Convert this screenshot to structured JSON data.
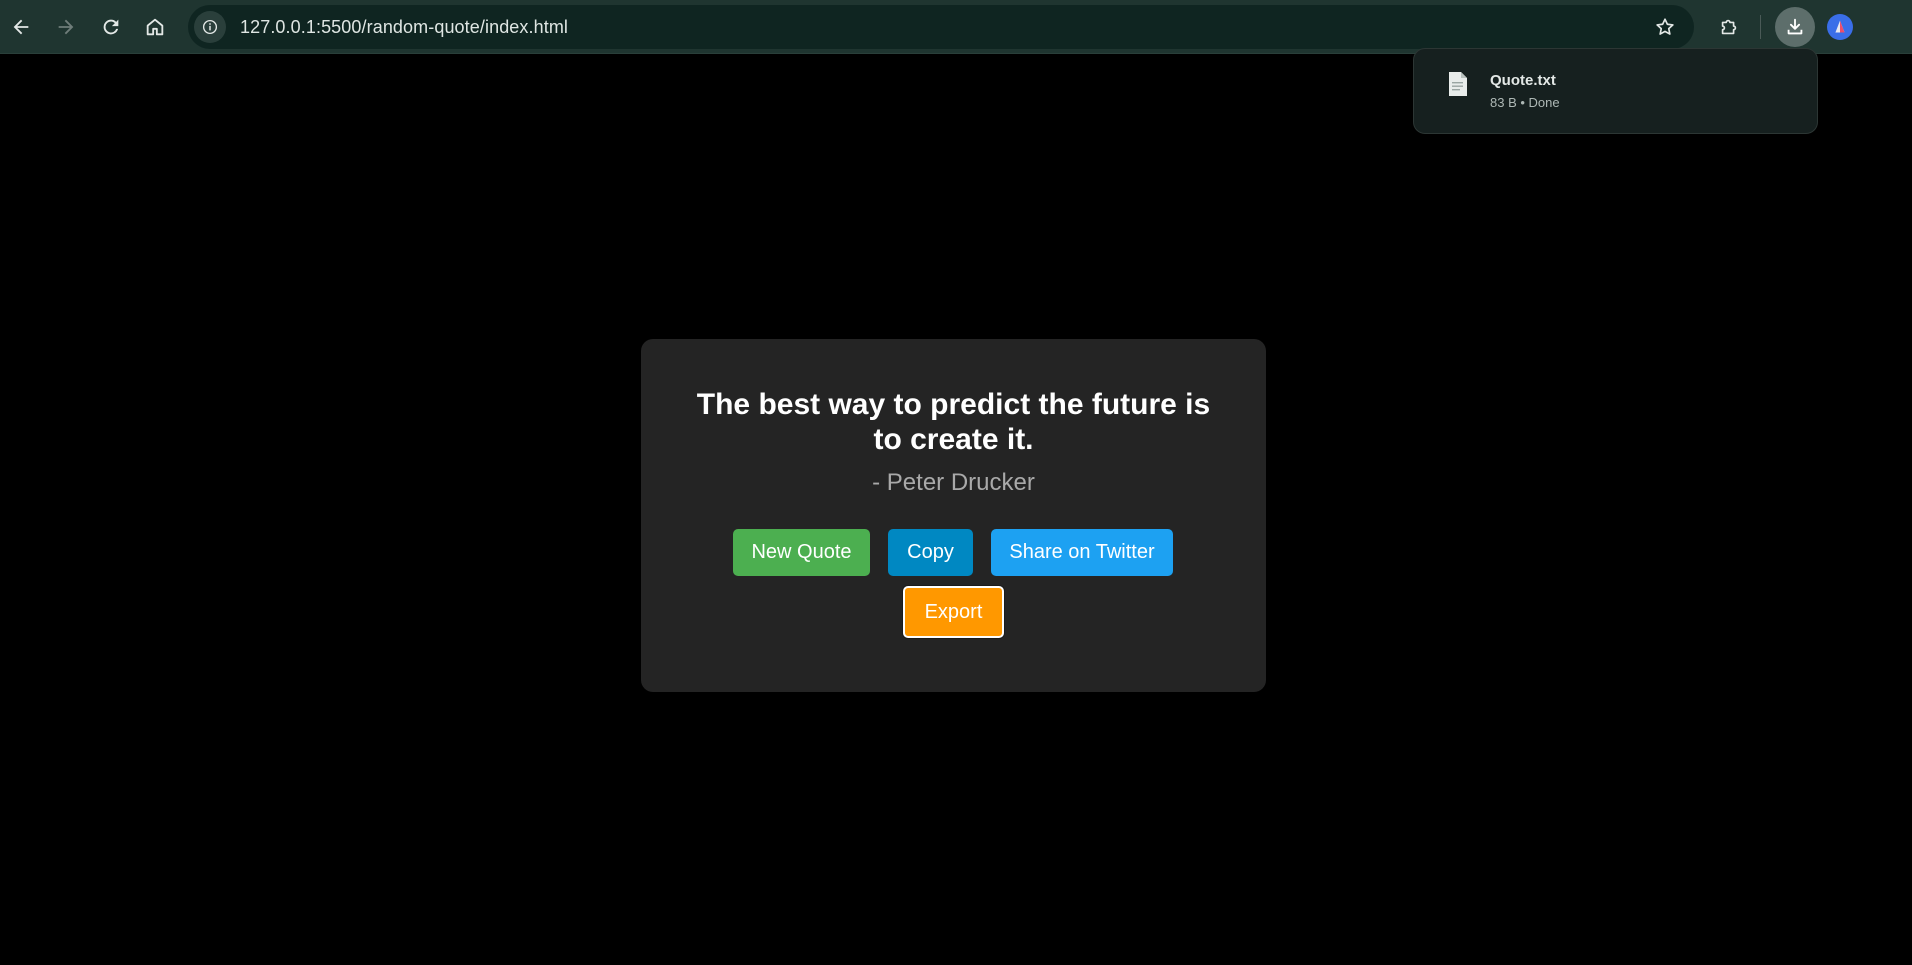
{
  "browser": {
    "url": "127.0.0.1:5500/random-quote/index.html",
    "icons": {
      "back": "back-arrow-icon",
      "forward": "forward-arrow-icon",
      "reload": "reload-icon",
      "home": "home-icon",
      "site_info": "info-icon",
      "bookmark": "star-icon",
      "extensions": "puzzle-piece-icon",
      "downloads": "download-icon",
      "profile": "avatar-icon"
    }
  },
  "download": {
    "file_name": "Quote.txt",
    "status": "83 B • Done"
  },
  "quote": {
    "text": "The best way to predict the future is to create it.",
    "author": "- Peter Drucker"
  },
  "buttons": {
    "new_quote": "New Quote",
    "copy": "Copy",
    "share": "Share on Twitter",
    "export": "Export"
  },
  "colors": {
    "page_background": "#000000",
    "card_background": "#242424",
    "new_quote": "#4caf50",
    "copy": "#0088c2",
    "share": "#1da1f2",
    "export": "#ff9800",
    "author_text": "#a9a9a9",
    "toolbar": "#1f3530"
  }
}
